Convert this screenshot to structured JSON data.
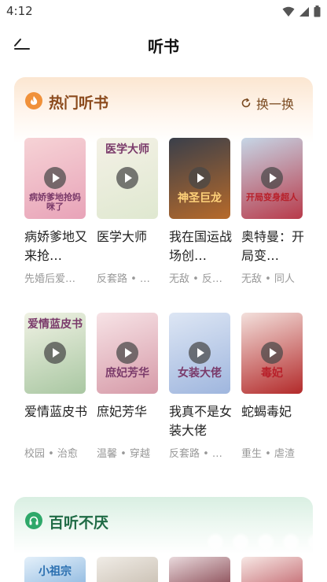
{
  "status_bar": {
    "time": "4:12"
  },
  "nav": {
    "title": "听书"
  },
  "hot_section": {
    "title": "热门听书",
    "refresh_label": "换一换",
    "books": [
      {
        "title": "病娇爹地又来抢…",
        "tags": "先婚后爱…",
        "cover_text": "病娇爹地抢妈咪了",
        "cover_colors": [
          "#f6d3d6",
          "#e8a3b8"
        ]
      },
      {
        "title": "医学大师",
        "tags": "反套路 • …",
        "cover_text": "医学大师",
        "cover_colors": [
          "#f4f1e6",
          "#dfe8d0"
        ]
      },
      {
        "title": "我在国运战场创…",
        "tags": "无敌 • 反…",
        "cover_text": "神圣巨龙",
        "cover_colors": [
          "#3a3f4a",
          "#b76a2a"
        ]
      },
      {
        "title": "奥特曼：开局变…",
        "tags": "无敌 • 同人",
        "cover_text": "开局变身超人",
        "cover_colors": [
          "#c6d6e6",
          "#b83a4a"
        ]
      },
      {
        "title": "爱情蓝皮书",
        "tags": "校园 • 治愈",
        "cover_text": "爱情蓝皮书",
        "cover_colors": [
          "#f0f2e4",
          "#a9c7a2"
        ]
      },
      {
        "title": "庶妃芳华",
        "tags": "温馨 • 穿越",
        "cover_text": "庶妃芳华",
        "cover_colors": [
          "#f7e3e6",
          "#d69aa8"
        ]
      },
      {
        "title": "我真不是女装大佬",
        "tags": "反套路 • …",
        "cover_text": "女装大佬",
        "cover_colors": [
          "#dde6f4",
          "#9fb6de"
        ]
      },
      {
        "title": "蛇蝎毒妃",
        "tags": "重生 • 虐渣",
        "cover_text": "毒妃",
        "cover_colors": [
          "#f3e0dc",
          "#b32a2a"
        ]
      }
    ]
  },
  "favorite_section": {
    "title": "百听不厌",
    "covers": [
      {
        "text": "小祖宗",
        "colors": [
          "#e4f0fa",
          "#8fb9e0"
        ]
      },
      {
        "text": "",
        "colors": [
          "#f0ece6",
          "#c9bfb2"
        ]
      },
      {
        "text": "",
        "colors": [
          "#e9d9dc",
          "#8a4b55"
        ]
      },
      {
        "text": "",
        "colors": [
          "#f7e7e4",
          "#c46b72"
        ]
      }
    ]
  },
  "colors": {
    "hot_accent": "#f0913a",
    "fav_accent": "#2fa86a",
    "hot_title": "#8b4a1c",
    "fav_title": "#1f6b45"
  }
}
